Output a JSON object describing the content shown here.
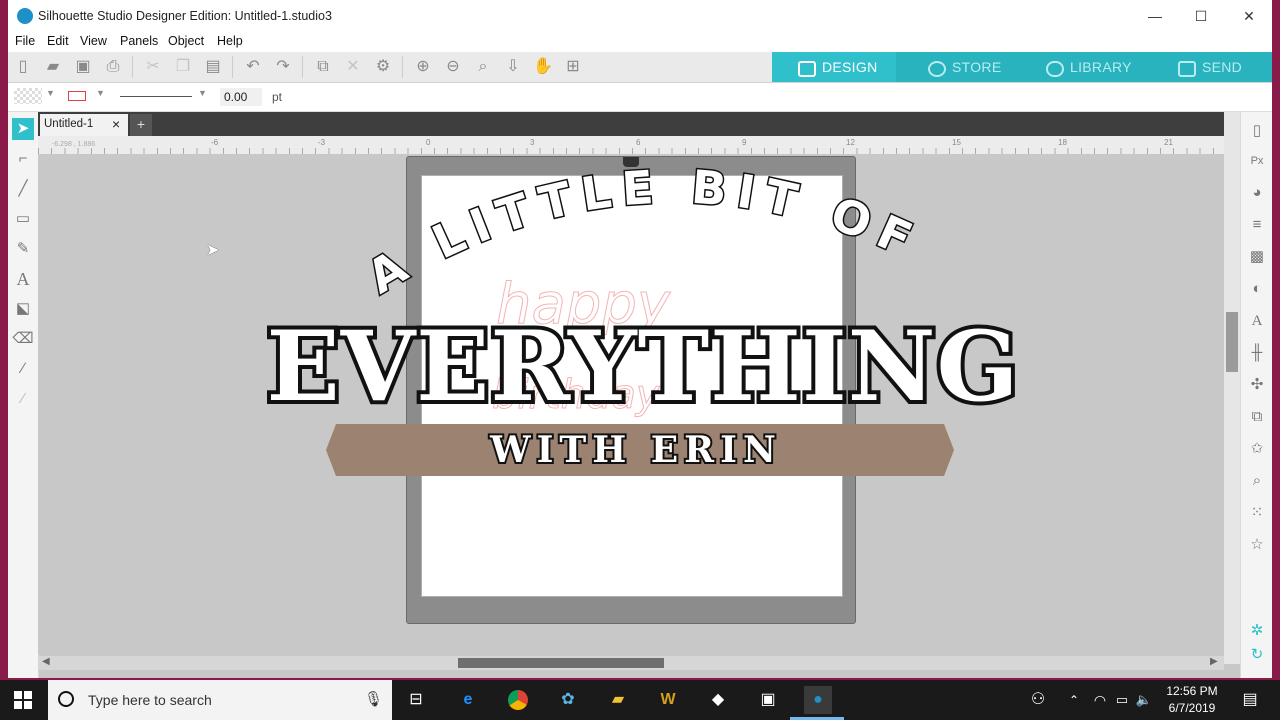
{
  "window": {
    "title": "Silhouette Studio Designer Edition: Untitled-1.studio3",
    "controls": [
      "—",
      "☐",
      "✕"
    ]
  },
  "menu": [
    "File",
    "Edit",
    "View",
    "Panels",
    "Object",
    "Help"
  ],
  "nav_tabs": [
    {
      "label": "DESIGN",
      "active": true,
      "icon": "grid-icon"
    },
    {
      "label": "STORE",
      "active": false,
      "icon": "silhouette-s-icon"
    },
    {
      "label": "LIBRARY",
      "active": false,
      "icon": "cloud-icon"
    },
    {
      "label": "SEND",
      "active": false,
      "icon": "cutter-icon"
    }
  ],
  "props": {
    "line_width": "0.00",
    "unit": "pt"
  },
  "doc_tab": {
    "label": "Untitled-1",
    "close": "×",
    "add": "+"
  },
  "ruler": {
    "coords": "-6.298 , 1.886",
    "labels": [
      "-6",
      "-3",
      "0",
      "3",
      "6",
      "9",
      "12",
      "15",
      "18",
      "21"
    ]
  },
  "overlay": {
    "arc_text": "A LITTLE BIT OF",
    "main_text": "EVERYTHING",
    "banner_text": "WITH ERIN",
    "faint_text_top": "happy",
    "faint_text_bottom": "birthday"
  },
  "taskbar": {
    "search_placeholder": "Type here to search",
    "time": "12:56 PM",
    "date": "6/7/2019"
  },
  "colors": {
    "accent": "#29b3bf",
    "accent_active": "#2fc0cc",
    "banner": "#9c8270",
    "mat": "#8c8c8c",
    "canvas": "#c8c8c8"
  }
}
